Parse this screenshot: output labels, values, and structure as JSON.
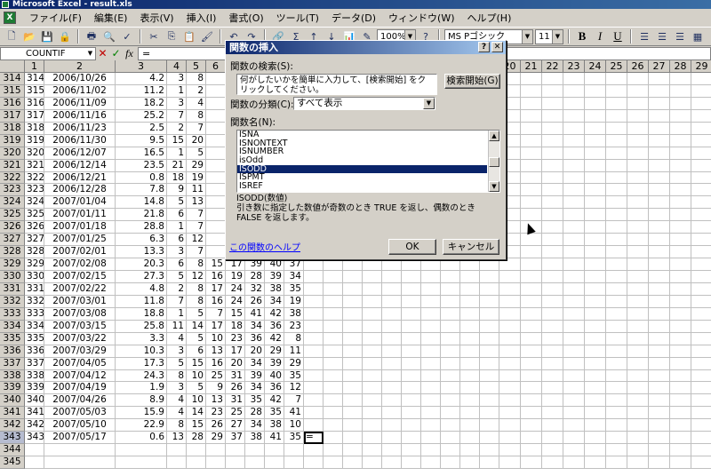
{
  "window": {
    "title": "Microsoft Excel - result.xls"
  },
  "menu": [
    "ファイル(F)",
    "編集(E)",
    "表示(V)",
    "挿入(I)",
    "書式(O)",
    "ツール(T)",
    "データ(D)",
    "ウィンドウ(W)",
    "ヘルプ(H)"
  ],
  "toolbar": {
    "zoom": "100%",
    "font_name": "MS Pゴシック",
    "font_size": "11"
  },
  "formula": {
    "name_box": "COUNTIF",
    "content": "="
  },
  "grid": {
    "column_headers": [
      "1",
      "2",
      "3",
      "4",
      "5",
      "6",
      "7",
      "8",
      "",
      "",
      "",
      "",
      "",
      "",
      "",
      "",
      "",
      "",
      "",
      "",
      "20",
      "21",
      "22",
      "23",
      "24",
      "25",
      "26",
      "27",
      "28",
      "29"
    ],
    "rows": [
      {
        "n": "314",
        "c": [
          "314",
          "2006/10/26",
          "4.2",
          "3",
          "8"
        ]
      },
      {
        "n": "315",
        "c": [
          "315",
          "2006/11/02",
          "11.2",
          "1",
          "2"
        ]
      },
      {
        "n": "316",
        "c": [
          "316",
          "2006/11/09",
          "18.2",
          "3",
          "4"
        ]
      },
      {
        "n": "317",
        "c": [
          "317",
          "2006/11/16",
          "25.2",
          "7",
          "8"
        ]
      },
      {
        "n": "318",
        "c": [
          "318",
          "2006/11/23",
          "2.5",
          "2",
          "7"
        ]
      },
      {
        "n": "319",
        "c": [
          "319",
          "2006/11/30",
          "9.5",
          "15",
          "20"
        ]
      },
      {
        "n": "320",
        "c": [
          "320",
          "2006/12/07",
          "16.5",
          "1",
          "5"
        ]
      },
      {
        "n": "321",
        "c": [
          "321",
          "2006/12/14",
          "23.5",
          "21",
          "29"
        ]
      },
      {
        "n": "322",
        "c": [
          "322",
          "2006/12/21",
          "0.8",
          "18",
          "19"
        ]
      },
      {
        "n": "323",
        "c": [
          "323",
          "2006/12/28",
          "7.8",
          "9",
          "11"
        ]
      },
      {
        "n": "324",
        "c": [
          "324",
          "2007/01/04",
          "14.8",
          "5",
          "13"
        ]
      },
      {
        "n": "325",
        "c": [
          "325",
          "2007/01/11",
          "21.8",
          "6",
          "7"
        ]
      },
      {
        "n": "326",
        "c": [
          "326",
          "2007/01/18",
          "28.8",
          "1",
          "7"
        ]
      },
      {
        "n": "327",
        "c": [
          "327",
          "2007/01/25",
          "6.3",
          "6",
          "12"
        ]
      },
      {
        "n": "328",
        "c": [
          "328",
          "2007/02/01",
          "13.3",
          "3",
          "7"
        ]
      },
      {
        "n": "329",
        "c": [
          "329",
          "2007/02/08",
          "20.3",
          "6",
          "8",
          "15",
          "17",
          "39",
          "40",
          "37"
        ]
      },
      {
        "n": "330",
        "c": [
          "330",
          "2007/02/15",
          "27.3",
          "5",
          "12",
          "16",
          "19",
          "28",
          "39",
          "34"
        ]
      },
      {
        "n": "331",
        "c": [
          "331",
          "2007/02/22",
          "4.8",
          "2",
          "8",
          "17",
          "24",
          "32",
          "38",
          "35"
        ]
      },
      {
        "n": "332",
        "c": [
          "332",
          "2007/03/01",
          "11.8",
          "7",
          "8",
          "16",
          "24",
          "26",
          "34",
          "19"
        ]
      },
      {
        "n": "333",
        "c": [
          "333",
          "2007/03/08",
          "18.8",
          "1",
          "5",
          "7",
          "15",
          "41",
          "42",
          "38"
        ]
      },
      {
        "n": "334",
        "c": [
          "334",
          "2007/03/15",
          "25.8",
          "11",
          "14",
          "17",
          "18",
          "34",
          "36",
          "23"
        ]
      },
      {
        "n": "335",
        "c": [
          "335",
          "2007/03/22",
          "3.3",
          "4",
          "5",
          "10",
          "23",
          "36",
          "42",
          "8"
        ]
      },
      {
        "n": "336",
        "c": [
          "336",
          "2007/03/29",
          "10.3",
          "3",
          "6",
          "13",
          "17",
          "20",
          "29",
          "11"
        ]
      },
      {
        "n": "337",
        "c": [
          "337",
          "2007/04/05",
          "17.3",
          "5",
          "15",
          "16",
          "20",
          "34",
          "39",
          "29"
        ]
      },
      {
        "n": "338",
        "c": [
          "338",
          "2007/04/12",
          "24.3",
          "8",
          "10",
          "25",
          "31",
          "39",
          "40",
          "35"
        ]
      },
      {
        "n": "339",
        "c": [
          "339",
          "2007/04/19",
          "1.9",
          "3",
          "5",
          "9",
          "26",
          "34",
          "36",
          "12"
        ]
      },
      {
        "n": "340",
        "c": [
          "340",
          "2007/04/26",
          "8.9",
          "4",
          "10",
          "13",
          "31",
          "35",
          "42",
          "7"
        ]
      },
      {
        "n": "341",
        "c": [
          "341",
          "2007/05/03",
          "15.9",
          "4",
          "14",
          "23",
          "25",
          "28",
          "35",
          "41"
        ]
      },
      {
        "n": "342",
        "c": [
          "342",
          "2007/05/10",
          "22.9",
          "8",
          "15",
          "26",
          "27",
          "34",
          "38",
          "10"
        ]
      },
      {
        "n": "343",
        "c": [
          "343",
          "2007/05/17",
          "0.6",
          "13",
          "28",
          "29",
          "37",
          "38",
          "41",
          "35",
          "="
        ]
      },
      {
        "n": "344",
        "c": []
      },
      {
        "n": "345",
        "c": []
      }
    ]
  },
  "dialog": {
    "title": "関数の挿入",
    "search_label": "関数の検索(S):",
    "search_text": "何がしたいかを簡単に入力して、[検索開始] をクリックしてください。",
    "search_button": "検索開始(G)",
    "category_label": "関数の分類(C):",
    "category_value": "すべて表示",
    "function_label": "関数名(N):",
    "functions": [
      "ISNA",
      "ISNONTEXT",
      "ISNUMBER",
      "isOdd",
      "ISODD",
      "ISPMT",
      "ISREF"
    ],
    "selected_function": "ISODD",
    "syntax": "ISODD(数値)",
    "description": "引き数に指定した数値が奇数のとき TRUE を返し、偶数のとき FALSE を返します。",
    "help_link": "この関数のヘルプ",
    "ok_label": "OK",
    "cancel_label": "キャンセル"
  }
}
